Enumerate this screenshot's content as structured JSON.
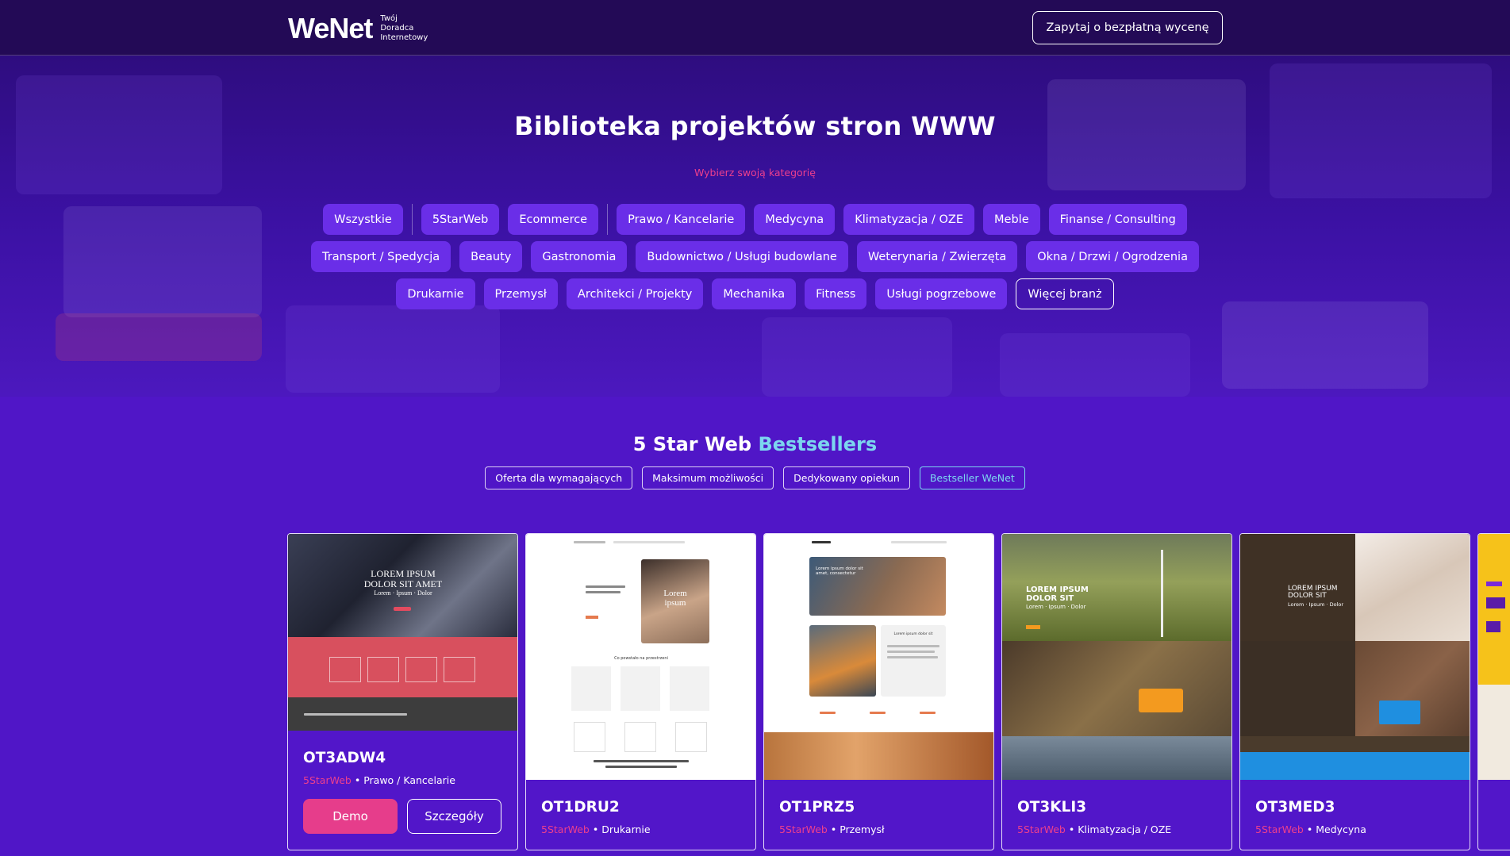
{
  "header": {
    "logo": "WeNet",
    "logo_tagline": [
      "Twój",
      "Doradca",
      "Internetowy"
    ],
    "cta_label": "Zapytaj o bezpłatną wycenę"
  },
  "hero": {
    "title": "Biblioteka projektów stron WWW",
    "subtitle": "Wybierz swoją kategorię",
    "categories_row1": [
      "Wszystkie",
      "5StarWeb",
      "Ecommerce",
      "Prawo / Kancelarie",
      "Medycyna",
      "Klimatyzacja / OZE",
      "Meble",
      "Finanse / Consulting"
    ],
    "categories_row2": [
      "Transport / Spedycja",
      "Beauty",
      "Gastronomia",
      "Budownictwo / Usługi budowlane",
      "Weterynaria / Zwierzęta",
      "Okna / Drzwi / Ogrodzenia"
    ],
    "categories_row3": [
      "Drukarnie",
      "Przemysł",
      "Architekci / Projekty",
      "Mechanika",
      "Fitness",
      "Usługi pogrzebowe"
    ],
    "more_label": "Więcej branż"
  },
  "bestsellers": {
    "title_main": "5 Star Web",
    "title_highlight": "Bestsellers",
    "tags": [
      "Oferta dla wymagających",
      "Maksimum możliwości",
      "Dedykowany opiekun",
      "Bestseller WeNet"
    ],
    "active_tag": "Bestseller WeNet",
    "demo_label": "Demo",
    "details_label": "Szczegóły",
    "cards": [
      {
        "code": "OT3ADW4",
        "brand": "5StarWeb",
        "category": "Prawo / Kancelarie",
        "preview_title": [
          "LOREM IPSUM",
          "DOLOR SIT AMET"
        ],
        "preview_sub": "Lorem · Ipsum · Dolor"
      },
      {
        "code": "OT1DRU2",
        "brand": "5StarWeb",
        "category": "Drukarnie",
        "preview_title": [
          "Lorem",
          "ipsum"
        ],
        "preview_sub": "Co powstało na przestrzeni"
      },
      {
        "code": "OT1PRZ5",
        "brand": "5StarWeb",
        "category": "Przemysł",
        "preview_title": [
          "Lorem ipsum dolor sit",
          "amet, consectetur"
        ],
        "preview_sub": "Lorem ipsum dolor sit"
      },
      {
        "code": "OT3KLI3",
        "brand": "5StarWeb",
        "category": "Klimatyzacja / OZE",
        "preview_title": [
          "LOREM IPSUM",
          "DOLOR SIT"
        ],
        "preview_sub": "Lorem · Ipsum · Dolor"
      },
      {
        "code": "OT3MED3",
        "brand": "5StarWeb",
        "category": "Medycyna",
        "preview_title": [
          "LOREM IPSUM",
          "DOLOR SIT"
        ],
        "preview_sub": "Lorem · Ipsum · Dolor"
      }
    ]
  },
  "colors": {
    "header_bg": "#230a56",
    "section_bg": "#5016c7",
    "chip_bg": "#6a2ee8",
    "accent_pink": "#ec3f8d",
    "accent_cyan": "#7cd6ef"
  }
}
